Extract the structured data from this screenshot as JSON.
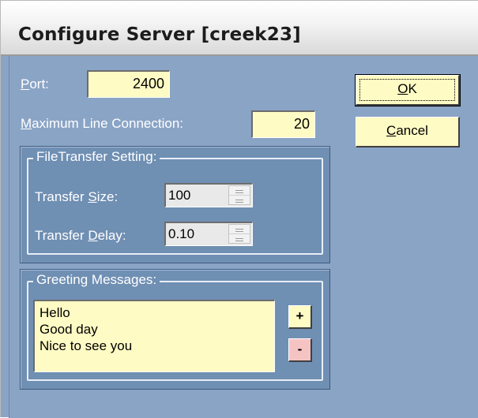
{
  "window": {
    "title": "Configure Server [creek23]"
  },
  "form": {
    "port": {
      "label_key": "P",
      "label_rest": "ort:",
      "value": "2400"
    },
    "max_line": {
      "label_key": "M",
      "label_rest": "aximum Line Connection:",
      "value": "20"
    }
  },
  "buttons": {
    "ok": {
      "key": "O",
      "rest": "K"
    },
    "cancel": {
      "key": "C",
      "rest": "ancel"
    }
  },
  "file_transfer": {
    "caption": "FileTransfer Setting:",
    "size": {
      "label_pre": "Transfer ",
      "label_key": "S",
      "label_rest": "ize:",
      "value": "100"
    },
    "delay": {
      "label_pre": "Transfer ",
      "label_key": "D",
      "label_rest": "elay:",
      "value": "0.10"
    }
  },
  "greetings": {
    "caption": "Greeting Messages:",
    "items": [
      "Hello",
      "Good day",
      "Nice to see you"
    ],
    "add_label": "+",
    "remove_label": "-"
  },
  "colors": {
    "dialog_bg": "#8aa4c6",
    "group_bg": "#6f8fb3",
    "field_bg": "#fffbc4",
    "remove_button_bg": "#f6c3c3"
  }
}
